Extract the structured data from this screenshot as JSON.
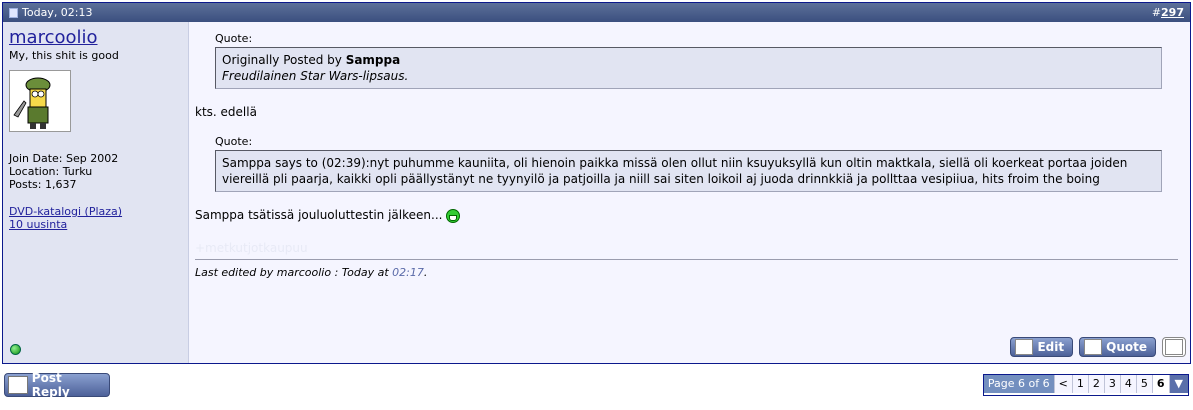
{
  "post": {
    "date": "Today, 02:13",
    "number_prefix": "#",
    "number": "297"
  },
  "user": {
    "name": "marcoolio",
    "title": "My, this shit is good",
    "join_date": "Join Date: Sep 2002",
    "location": "Location: Turku",
    "posts": "Posts: 1,637",
    "links": [
      "DVD-katalogi (Plaza)",
      "10 uusinta"
    ],
    "online": true
  },
  "message": {
    "quote1_label": "Quote:",
    "quote1_prefix": "Originally Posted by",
    "quote1_author": "Samppa",
    "quote1_text": "Freudilainen Star Wars-lipsaus.",
    "text1": "kts. edellä",
    "quote2_label": "Quote:",
    "quote2_text": "Samppa says to (02:39):nyt puhumme kauniita, oli hienoin paikka missä olen ollut niin ksuyuksyllä kun oltin maktkala, siellä oli koerkeat portaa joiden viereillä pli paarja, kaikki opli päällystänyt ne tyynyilö ja patjoilla ja niill sai siten loikoil aj juoda drinnkkiä ja pollttaa vesipiiua, hits froim the boing",
    "text2": "Samppa tsätissä jouluoluttestin jälkeen...",
    "signature": "+metkutjotkaupuu",
    "edited_prefix": "Last edited by marcoolio : Today at",
    "edited_time": "02:17",
    "edited_suffix": "."
  },
  "buttons": {
    "edit": "Edit",
    "quote": "Quote",
    "post_reply": "Post Reply"
  },
  "pagination": {
    "label": "Page 6 of 6",
    "prev": "<",
    "pages": [
      "1",
      "2",
      "3",
      "4",
      "5"
    ],
    "current": "6",
    "menu": "▼"
  },
  "colors": {
    "header": "#3b4f7f",
    "accent_link": "#22229c",
    "online": "#109010"
  }
}
